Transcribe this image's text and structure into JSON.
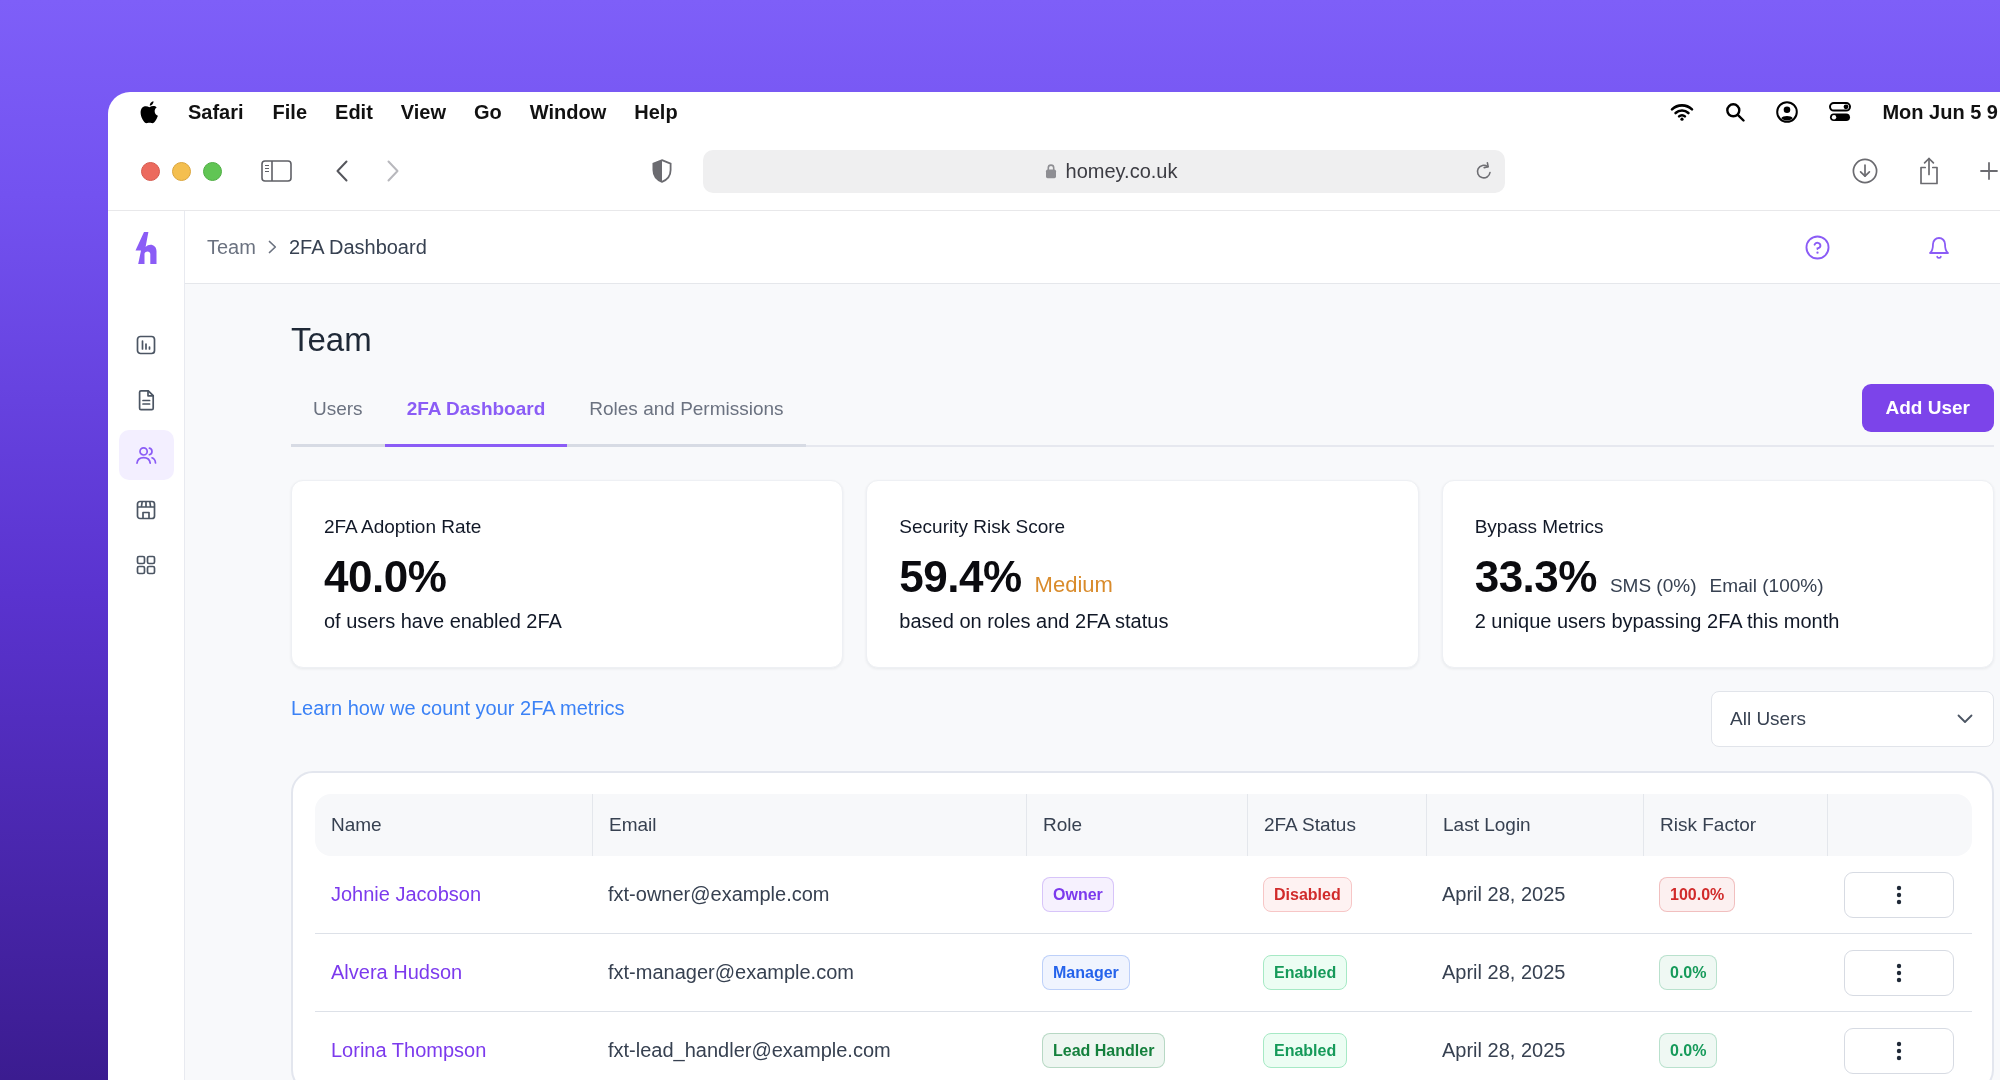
{
  "menu_bar": {
    "app_name": "Safari",
    "menus": [
      "File",
      "Edit",
      "View",
      "Go",
      "Window",
      "Help"
    ],
    "clock": "Mon Jun 5 9"
  },
  "browser": {
    "address": "homey.co.uk"
  },
  "sidebar": {
    "items": [
      {
        "selected": false
      },
      {
        "selected": false
      },
      {
        "selected": true
      },
      {
        "selected": false
      },
      {
        "selected": false
      }
    ]
  },
  "breadcrumb": [
    "Team",
    "2FA Dashboard"
  ],
  "page": {
    "title": "Team",
    "tabs": [
      {
        "label": "Users",
        "selected": false
      },
      {
        "label": "2FA Dashboard",
        "selected": true
      },
      {
        "label": "Roles and Permissions",
        "selected": false
      }
    ],
    "add_button": "Add User"
  },
  "cards": [
    {
      "title": "2FA Adoption Rate",
      "value": "40.0%",
      "note": "of users have enabled 2FA"
    },
    {
      "title": "Security Risk Score",
      "value": "59.4%",
      "rating": "Medium",
      "note": "based on roles and 2FA status"
    },
    {
      "title": "Bypass Metrics",
      "value": "33.3%",
      "details": [
        "SMS (0%)",
        "Email (100%)"
      ],
      "note": "2 unique users bypassing 2FA this month"
    }
  ],
  "metrics_link": "Learn how we count your 2FA metrics",
  "user_filter": {
    "value": "All Users"
  },
  "table": {
    "columns": [
      "Name",
      "Email",
      "Role",
      "2FA Status",
      "Last Login",
      "Risk Factor"
    ],
    "rows": [
      {
        "name": "Johnie Jacobson",
        "email": "fxt-owner@example.com",
        "role": {
          "label": "Owner",
          "color": "#7c3aed"
        },
        "status": {
          "label": "Disabled",
          "enabled": false
        },
        "last_login": "April 28, 2025",
        "risk": {
          "label": "100.0%",
          "color": "#d12b2b"
        }
      },
      {
        "name": "Alvera Hudson",
        "email": "fxt-manager@example.com",
        "role": {
          "label": "Manager",
          "color": "#2563eb"
        },
        "status": {
          "label": "Enabled",
          "enabled": true
        },
        "last_login": "April 28, 2025",
        "risk": {
          "label": "0.0%",
          "color": "#169a5a"
        }
      },
      {
        "name": "Lorina Thompson",
        "email": "fxt-lead_handler@example.com",
        "role": {
          "label": "Lead Handler",
          "color": "#15803d"
        },
        "status": {
          "label": "Enabled",
          "enabled": true
        },
        "last_login": "April 28, 2025",
        "risk": {
          "label": "0.0%",
          "color": "#169a5a"
        }
      }
    ]
  }
}
